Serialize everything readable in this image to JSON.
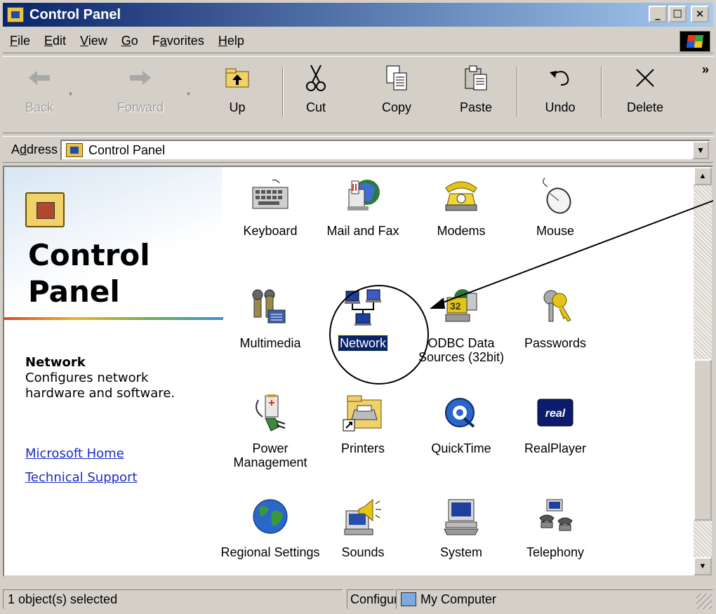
{
  "window": {
    "title": "Control Panel",
    "controls": {
      "minimize": "_",
      "maximize": "☐",
      "close": "✕"
    }
  },
  "menu": [
    {
      "label": "File",
      "key": "F",
      "rest": "ile"
    },
    {
      "label": "Edit",
      "key": "E",
      "rest": "dit"
    },
    {
      "label": "View",
      "key": "V",
      "rest": "iew"
    },
    {
      "label": "Go",
      "key": "G",
      "rest": "o"
    },
    {
      "label": "Favorites",
      "pre": "F",
      "key": "a",
      "rest": "vorites"
    },
    {
      "label": "Help",
      "key": "H",
      "rest": "elp"
    }
  ],
  "toolbar": {
    "back": "Back",
    "forward": "Forward",
    "up": "Up",
    "cut": "Cut",
    "copy": "Copy",
    "paste": "Paste",
    "undo": "Undo",
    "delete": "Delete",
    "more": "»"
  },
  "address": {
    "label_pre": "A",
    "label_key": "d",
    "label_rest": "dress",
    "value": "Control Panel"
  },
  "left_pane": {
    "title_line1": "Control",
    "title_line2": "Panel",
    "selected_name": "Network",
    "selected_description": "Configures network hardware and software.",
    "links": [
      "Microsoft Home",
      "Technical Support"
    ]
  },
  "items": [
    {
      "label": "Keyboard",
      "icon": "keyboard-icon"
    },
    {
      "label": "Mail and Fax",
      "icon": "mail-fax-icon"
    },
    {
      "label": "Modems",
      "icon": "modem-icon"
    },
    {
      "label": "Mouse",
      "icon": "mouse-icon"
    },
    {
      "label": "Multimedia",
      "icon": "multimedia-icon"
    },
    {
      "label": "Network",
      "icon": "network-icon",
      "selected": true
    },
    {
      "label": "ODBC Data Sources (32bit)",
      "icon": "odbc-icon"
    },
    {
      "label": "Passwords",
      "icon": "passwords-icon"
    },
    {
      "label": "Power Management",
      "icon": "power-icon"
    },
    {
      "label": "Printers",
      "icon": "printers-icon"
    },
    {
      "label": "QuickTime",
      "icon": "quicktime-icon"
    },
    {
      "label": "RealPlayer",
      "icon": "realplayer-icon",
      "badge": "real"
    },
    {
      "label": "Regional Settings",
      "icon": "globe-icon"
    },
    {
      "label": "Sounds",
      "icon": "sounds-icon"
    },
    {
      "label": "System",
      "icon": "system-icon"
    },
    {
      "label": "Telephony",
      "icon": "telephony-icon"
    }
  ],
  "status": {
    "selection": "1 object(s) selected",
    "hint": "Configur",
    "zone": "My Computer"
  },
  "colors": {
    "title_start": "#0a246a",
    "title_end": "#a6caf0",
    "selection": "#0a246a",
    "link": "#1b2cc5",
    "chrome": "#d4d0c8"
  }
}
